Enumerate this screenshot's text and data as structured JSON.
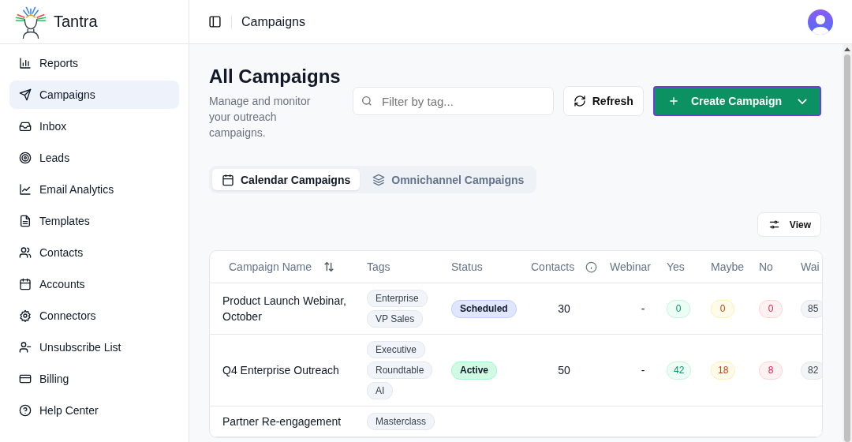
{
  "brand": {
    "name": "Tantra"
  },
  "sidebar": {
    "items": [
      {
        "label": "Reports",
        "selected": false
      },
      {
        "label": "Campaigns",
        "selected": true
      },
      {
        "label": "Inbox",
        "selected": false
      },
      {
        "label": "Leads",
        "selected": false
      },
      {
        "label": "Email Analytics",
        "selected": false
      },
      {
        "label": "Templates",
        "selected": false
      },
      {
        "label": "Contacts",
        "selected": false
      },
      {
        "label": "Accounts",
        "selected": false
      },
      {
        "label": "Connectors",
        "selected": false
      },
      {
        "label": "Unsubscribe List",
        "selected": false
      },
      {
        "label": "Billing",
        "selected": false
      },
      {
        "label": "Help Center",
        "selected": false
      }
    ]
  },
  "header": {
    "title": "Campaigns"
  },
  "page": {
    "title": "All Campaigns",
    "subtitle": "Manage and monitor your outreach campaigns.",
    "search": {
      "placeholder": "Filter by tag..."
    },
    "refresh_button": "Refresh",
    "create_button": "Create Campaign",
    "tabs": [
      {
        "label": "Calendar Campaigns",
        "selected": true
      },
      {
        "label": "Omnichannel Campaigns",
        "selected": false
      }
    ],
    "view_button": "View"
  },
  "table": {
    "columns": [
      {
        "label": "Campaign Name",
        "kind": "sort"
      },
      {
        "label": "Tags",
        "kind": "plain"
      },
      {
        "label": "Status",
        "kind": "plain"
      },
      {
        "label": "Contacts",
        "kind": "info"
      },
      {
        "label": "Webinar",
        "kind": "plain"
      },
      {
        "label": "Yes",
        "kind": "plain"
      },
      {
        "label": "Maybe",
        "kind": "plain"
      },
      {
        "label": "No",
        "kind": "plain"
      },
      {
        "label": "Wai",
        "kind": "plain"
      }
    ],
    "rows": [
      {
        "name": "Product Launch Webinar, October",
        "tags": [
          "Enterprise",
          "VP Sales"
        ],
        "status": {
          "label": "Scheduled",
          "kind": "scheduled"
        },
        "contacts": "30",
        "webinar": "-",
        "yes": "0",
        "maybe": "0",
        "no": "0",
        "column_9": "85"
      },
      {
        "name": "Q4 Enterprise Outreach",
        "tags": [
          "Executive",
          "Roundtable",
          "AI"
        ],
        "status": {
          "label": "Active",
          "kind": "active"
        },
        "contacts": "50",
        "webinar": "-",
        "yes": "42",
        "maybe": "18",
        "no": "8",
        "column_9": "82"
      },
      {
        "name": "Partner Re-engagement",
        "tags": [
          "Masterclass"
        ]
      }
    ]
  }
}
